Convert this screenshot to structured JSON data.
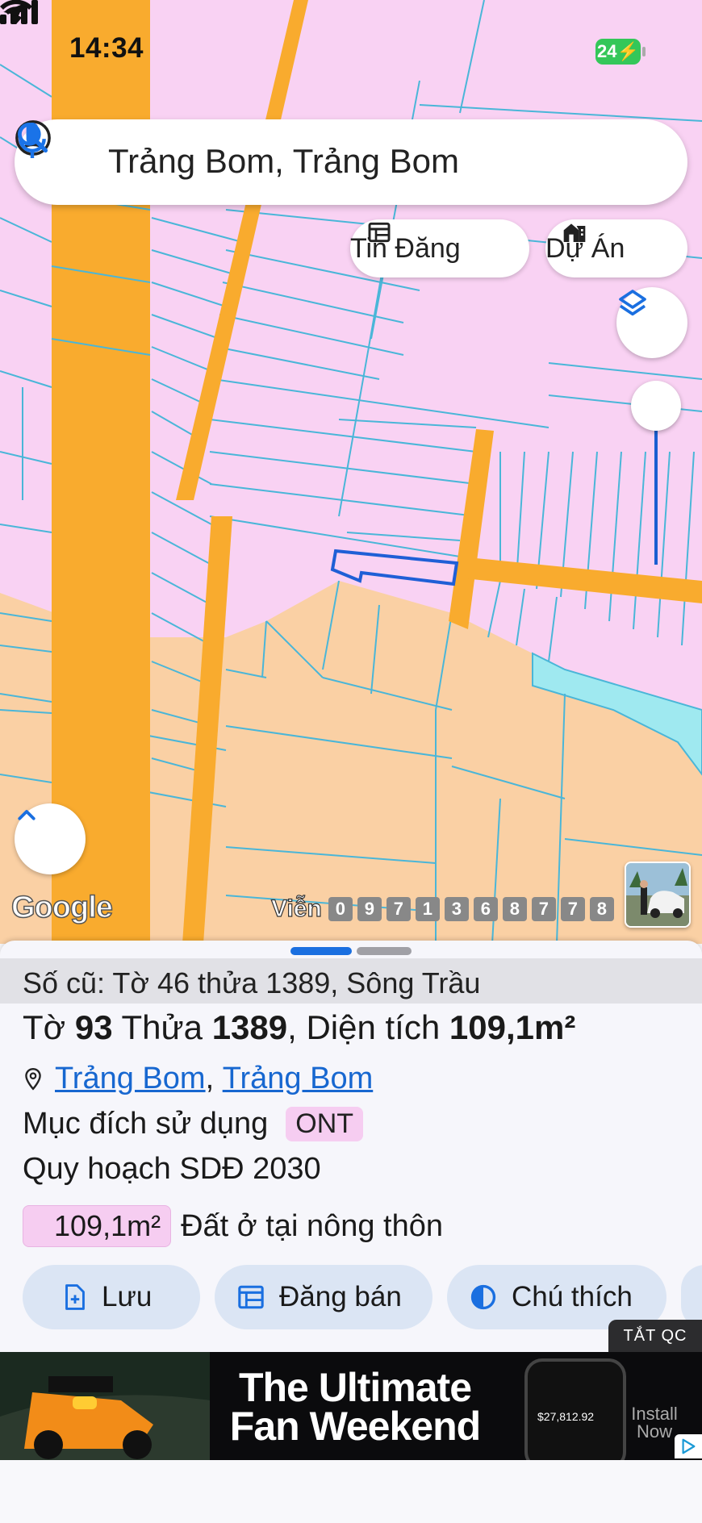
{
  "status_bar": {
    "time": "14:34",
    "battery": "24"
  },
  "search": {
    "query": "Trảng Bom, Trảng Bom"
  },
  "chips": [
    {
      "label": "Tin Đăng",
      "icon": "listing-icon"
    },
    {
      "label": "Dự Án",
      "icon": "project-icon"
    }
  ],
  "map": {
    "google_label": "Google",
    "counter_label": "Viễn",
    "counter_digits": [
      "0",
      "9",
      "7",
      "1",
      "3",
      "6",
      "8",
      "7",
      "7",
      "8"
    ],
    "colors": {
      "residential": "#f9d2f3",
      "agricultural": "#fad0a4",
      "road": "#f9ab2e",
      "water": "#9fe9f0",
      "parcel_line": "#4ab6d8",
      "selected": "#1f5fd6"
    }
  },
  "sheet": {
    "old_info": "Số cũ: Tờ 46 thửa 1389, Sông Trầu",
    "title": {
      "to_label": "Tờ",
      "to_num": "93",
      "thua_label": "Thửa",
      "thua_num": "1389",
      "area_label": ", Diện tích",
      "area_value": "109,1m²"
    },
    "address": {
      "part1": "Trảng Bom",
      "sep": ",",
      "part2": "Trảng Bom"
    },
    "purpose": {
      "label": "Mục đích sử dụng",
      "code": "ONT"
    },
    "plan": "Quy hoạch SDĐ 2030",
    "plan_area": {
      "value": "109,1m²",
      "description": "Đất ở tại nông thôn"
    },
    "actions": [
      {
        "label": "Lưu"
      },
      {
        "label": "Đăng bán"
      },
      {
        "label": "Chú thích"
      }
    ]
  },
  "ad": {
    "toggle": "TẮT QC",
    "headline_line1": "The Ultimate",
    "headline_line2": "Fan Weekend",
    "cta_line1": "Install",
    "cta_line2": "Now",
    "phone_value": "$27,812.92"
  }
}
